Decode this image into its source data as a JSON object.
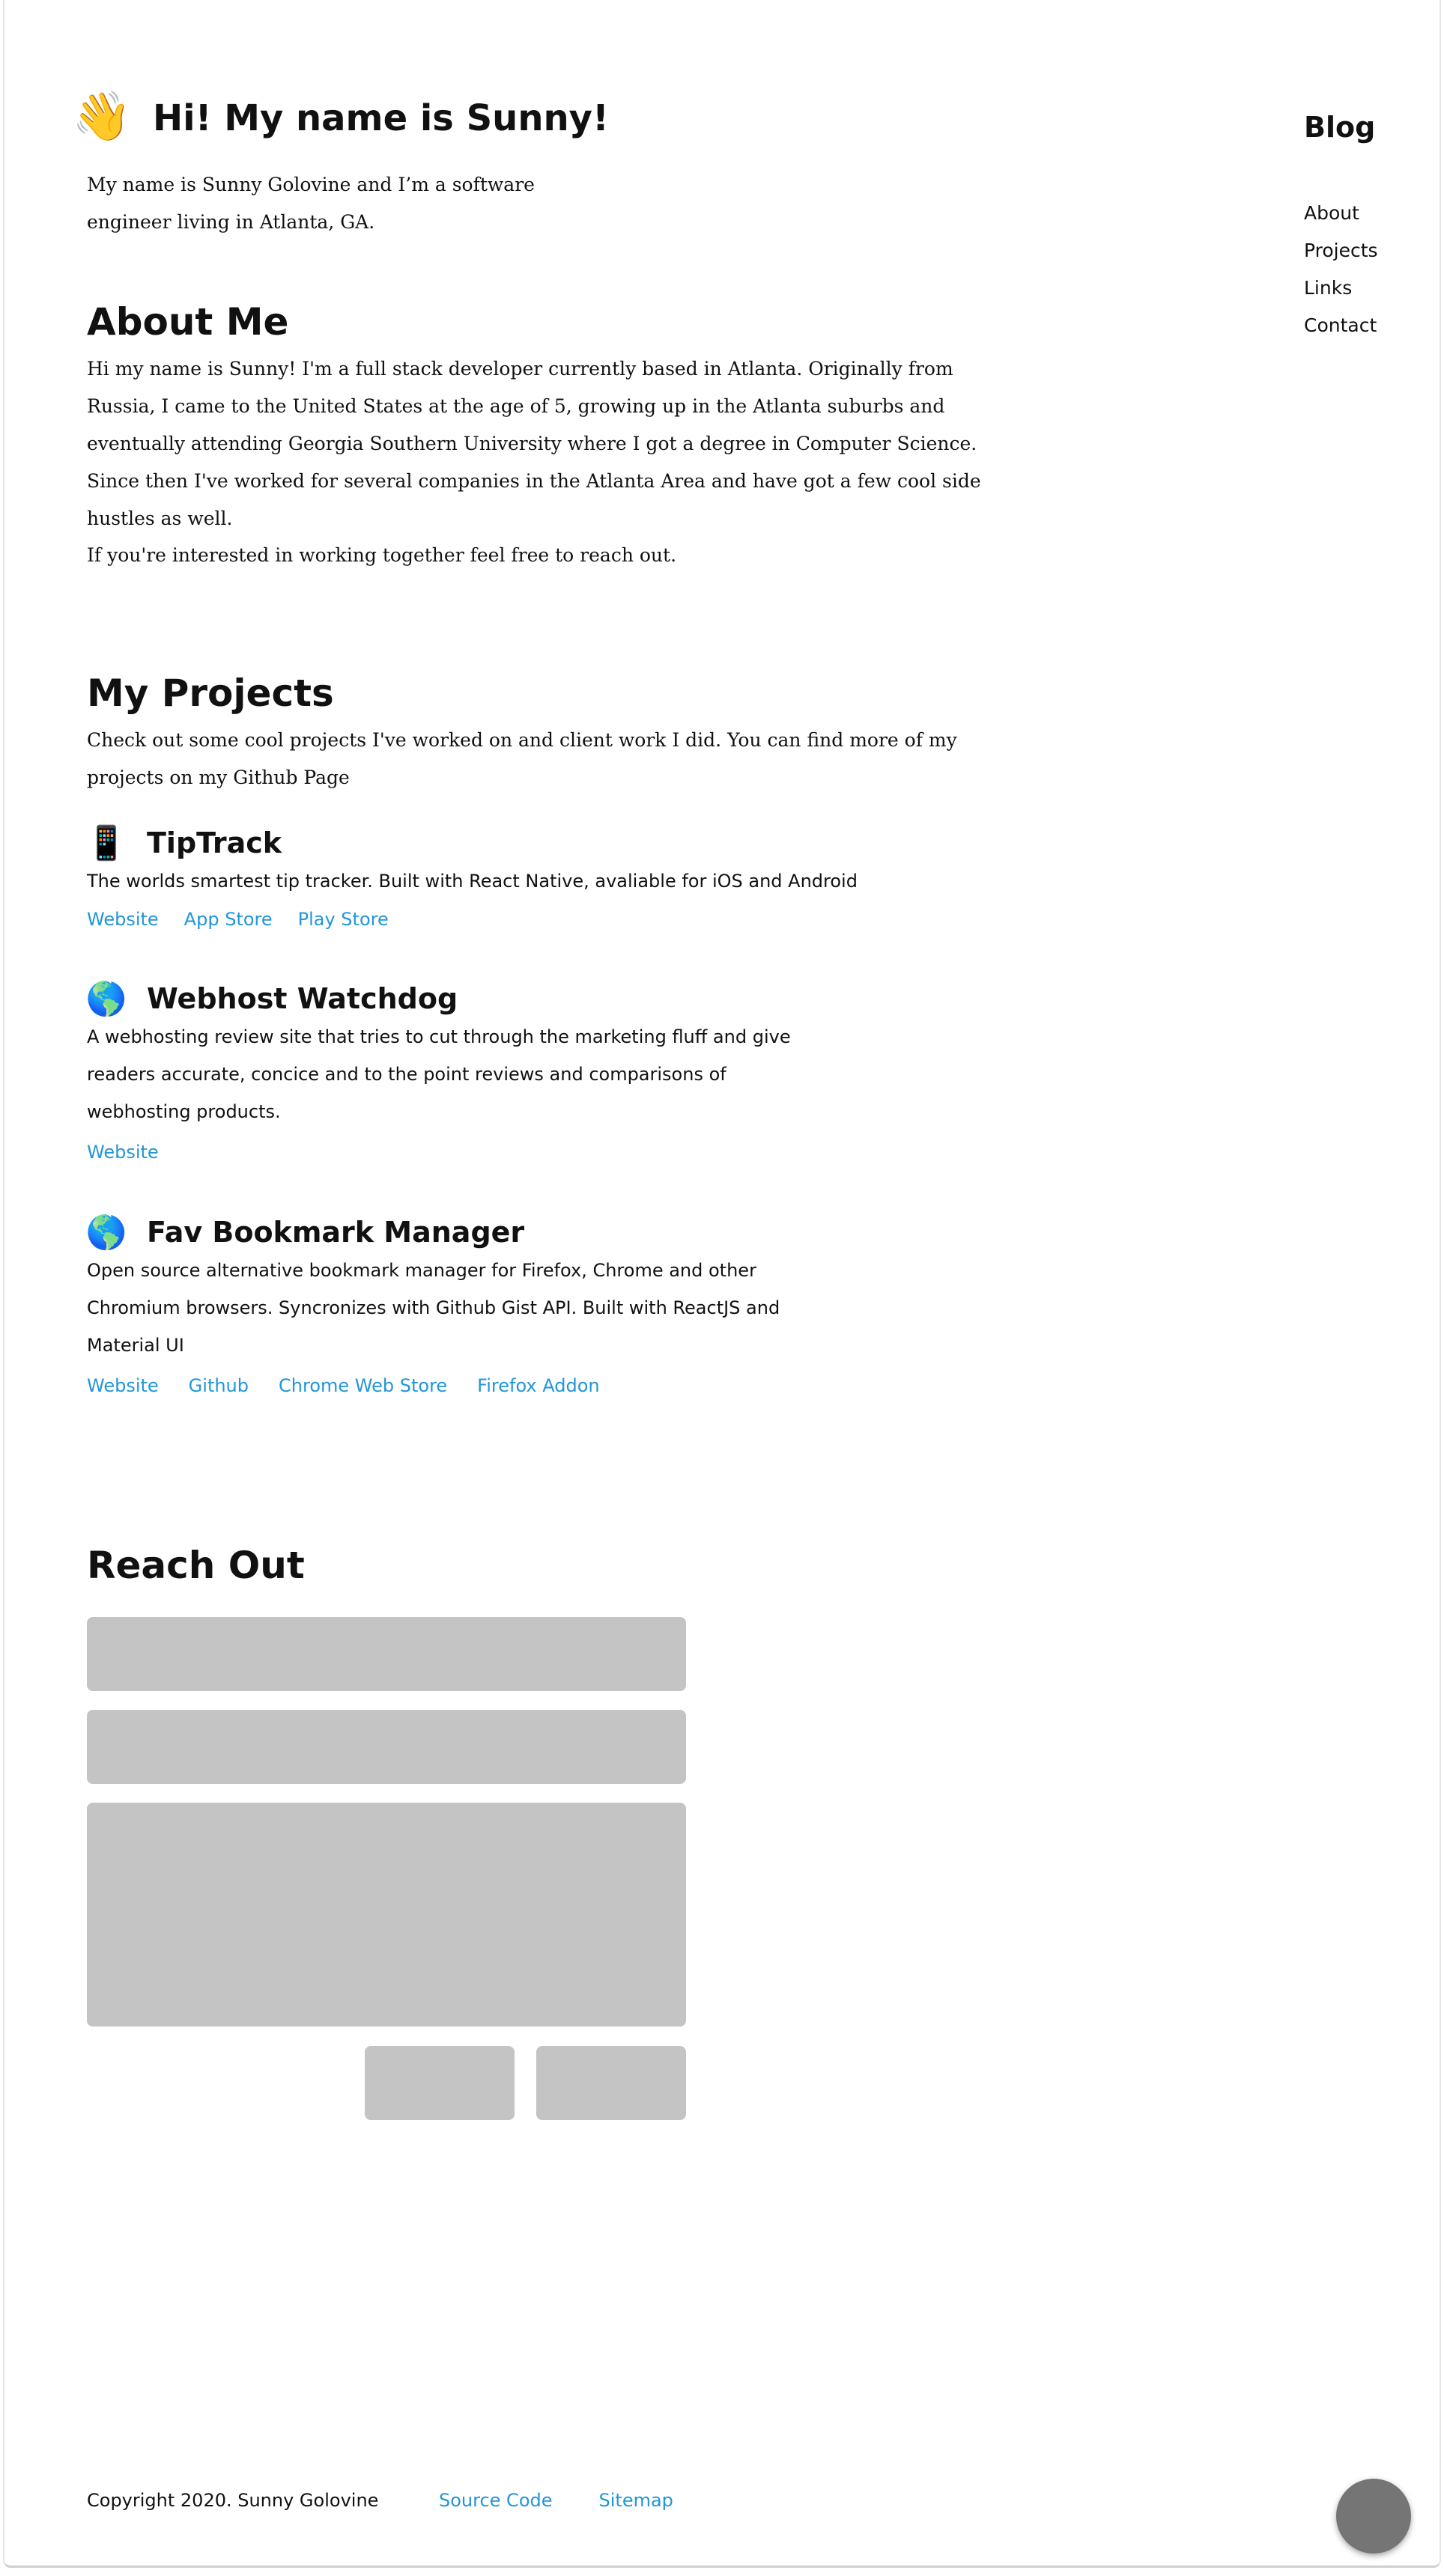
{
  "header": {
    "wave_icon": "👋",
    "title": "Hi! My name is Sunny!",
    "subtitle": "My name is Sunny Golovine and I’m a software engineer living in Atlanta, GA."
  },
  "nav": {
    "blog_label": "Blog",
    "items": [
      "About",
      "Projects",
      "Links",
      "Contact"
    ]
  },
  "about": {
    "title": "About Me",
    "paragraph1": "Hi my name is Sunny! I'm a full stack developer currently based in Atlanta. Originally from Russia, I came to the United States at the age of 5, growing up in the Atlanta suburbs and eventually attending Georgia Southern University where I got a degree in Computer Science. Since then I've worked for several companies in the Atlanta Area and have got a few cool side hustles as well.",
    "paragraph2": "If you're interested in working together feel free to reach out."
  },
  "projects": {
    "title": "My Projects",
    "intro": "Check out some cool projects I've worked on and client work I did. You can find more of my projects on my Github Page",
    "items": [
      {
        "icon": "📱",
        "name": "TipTrack",
        "description": "The worlds smartest tip tracker. Built with React Native, avaliable for iOS and Android",
        "links": [
          "Website",
          "App Store",
          "Play Store"
        ]
      },
      {
        "icon": "🌎",
        "name": "Webhost Watchdog",
        "description": "A webhosting review site that tries to cut through the marketing fluff and give readers accurate, concice and to the point reviews and comparisons of webhosting products.",
        "links": [
          "Website"
        ]
      },
      {
        "icon": "🌎",
        "name": "Fav Bookmark Manager",
        "description": "Open source alternative bookmark manager for Firefox, Chrome and other Chromium browsers. Syncronizes with Github Gist API. Built with ReactJS and Material UI",
        "links": [
          "Website",
          "Github",
          "Chrome Web Store",
          "Firefox Addon"
        ]
      }
    ]
  },
  "reach_out": {
    "title": "Reach Out"
  },
  "footer": {
    "copyright": "Copyright 2020. Sunny Golovine",
    "links": [
      "Source Code",
      "Sitemap"
    ]
  },
  "colors": {
    "link": "#2196d9",
    "placeholder_field": "#c4c4c4",
    "fab": "#757575"
  }
}
